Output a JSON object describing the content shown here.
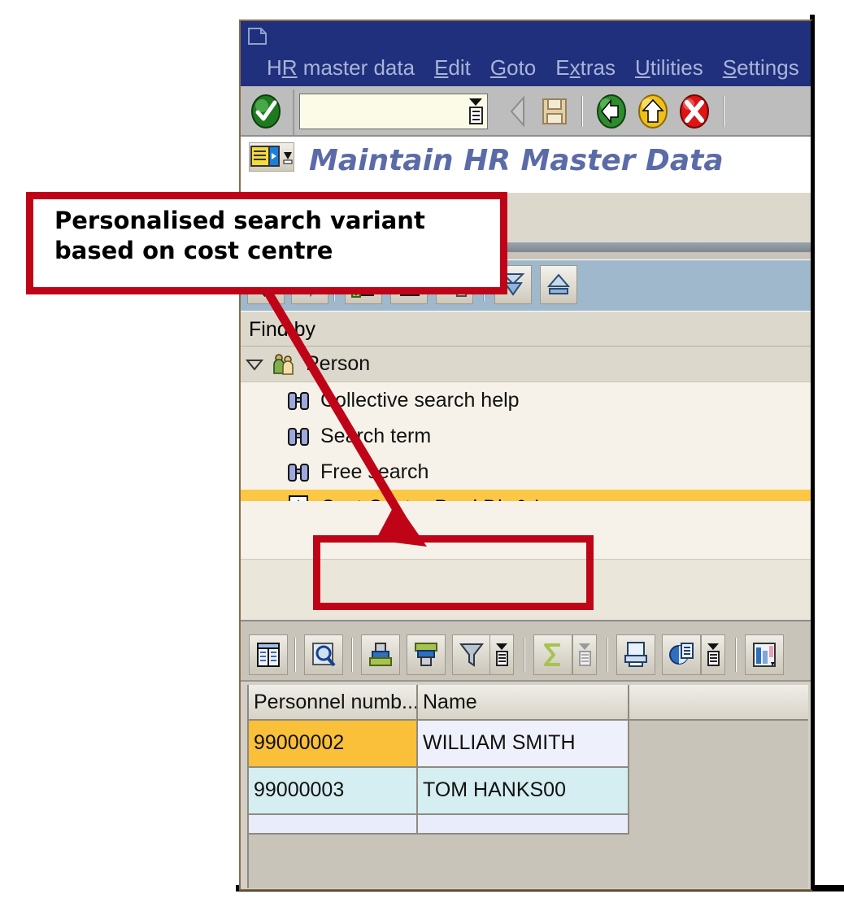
{
  "window": {
    "system_icon": "sap-window-icon",
    "menu": [
      {
        "label": "HR master data",
        "accel": "R"
      },
      {
        "label": "Edit",
        "accel": "E"
      },
      {
        "label": "Goto",
        "accel": "G"
      },
      {
        "label": "Extras",
        "accel": "x"
      },
      {
        "label": "Utilities",
        "accel": "U"
      },
      {
        "label": "Settings",
        "accel": "S"
      }
    ]
  },
  "command_bar": {
    "ok_icon": "green-check-icon",
    "command_value": "",
    "command_placeholder": "",
    "dropdown_icon": "command-dropdown-icon",
    "icons": [
      {
        "name": "back-arrow-icon",
        "glyph": "◀"
      },
      {
        "name": "save-icon",
        "glyph": "💾"
      },
      {
        "name": "back-green-icon",
        "glyph": "←"
      },
      {
        "name": "exit-yellow-icon",
        "glyph": "↑"
      },
      {
        "name": "cancel-red-icon",
        "glyph": "✕"
      }
    ]
  },
  "title": {
    "text": "Maintain HR Master Data",
    "menu_button_icon": "title-menu-icon"
  },
  "app_toolbar": {
    "buttons": [
      {
        "name": "picture-toolbar-button",
        "icon": "picture-icon"
      }
    ]
  },
  "search_toolbar": {
    "buttons": [
      {
        "name": "previous-button",
        "icon": "blue-left-arrow-icon"
      },
      {
        "name": "next-button",
        "icon": "blue-right-arrow-icon"
      },
      {
        "name": "create-search-variant-button",
        "icon": "page-plus-star-icon"
      },
      {
        "name": "change-search-variant-button",
        "icon": "page-star-icon"
      },
      {
        "name": "delete-search-variant-button",
        "icon": "page-star-trash-icon"
      },
      {
        "name": "expand-all-button",
        "icon": "double-down-arrow-icon"
      },
      {
        "name": "collapse-all-button",
        "icon": "up-arrow-icon"
      }
    ]
  },
  "find_by": {
    "label": "Find by",
    "tree": {
      "root": {
        "label": "Person",
        "icon": "person-group-icon",
        "twisty": "▽",
        "expanded": true
      },
      "children": [
        {
          "label": "Collective search help",
          "icon": "binoculars-icon",
          "selected": false
        },
        {
          "label": "Search term",
          "icon": "binoculars-icon",
          "selected": false
        },
        {
          "label": "Free search",
          "icon": "binoculars-icon",
          "selected": false
        },
        {
          "label": "Cost Center Prod Dir & In",
          "icon": "page-star-icon",
          "selected": true
        }
      ]
    }
  },
  "alv_toolbar": {
    "buttons": [
      {
        "name": "detail-button",
        "icon": "detail-list-icon"
      },
      {
        "name": "find-button",
        "icon": "magnifier-icon"
      },
      {
        "name": "sort-ascending-button",
        "icon": "sort-asc-icon"
      },
      {
        "name": "sort-descending-button",
        "icon": "sort-desc-icon"
      },
      {
        "name": "filter-button",
        "icon": "funnel-icon"
      },
      {
        "name": "filter-menu-button",
        "icon": "menu-dropdown-icon"
      },
      {
        "name": "total-button",
        "icon": "sigma-icon"
      },
      {
        "name": "subtotal-menu-button",
        "icon": "menu-dropdown-icon"
      },
      {
        "name": "print-button",
        "icon": "print-icon"
      },
      {
        "name": "export-button",
        "icon": "export-icon"
      },
      {
        "name": "export-menu-button",
        "icon": "menu-dropdown-icon"
      },
      {
        "name": "layout-button",
        "icon": "layout-icon"
      }
    ]
  },
  "result_grid": {
    "columns": [
      {
        "key": "personnel_number",
        "label": "Personnel numb..."
      },
      {
        "key": "name",
        "label": "Name"
      },
      {
        "key": "blank",
        "label": ""
      }
    ],
    "rows": [
      {
        "personnel_number": "99000002",
        "name": "WILLIAM SMITH",
        "selected": true
      },
      {
        "personnel_number": "99000003",
        "name": "TOM HANKS00",
        "selected": false
      }
    ]
  },
  "annotation": {
    "callout_text": "Personalised search variant based on cost centre",
    "callout_line1": "Personalised search variant",
    "callout_line2": "based on cost centre",
    "accent_color": "#c00418",
    "highlight_target": "Cost Center Prod Dir & In"
  },
  "colors": {
    "menubar": "#20307c",
    "selected_row": "#fbc745",
    "title_text": "#5b6ba8",
    "annotation_red": "#c00418"
  }
}
